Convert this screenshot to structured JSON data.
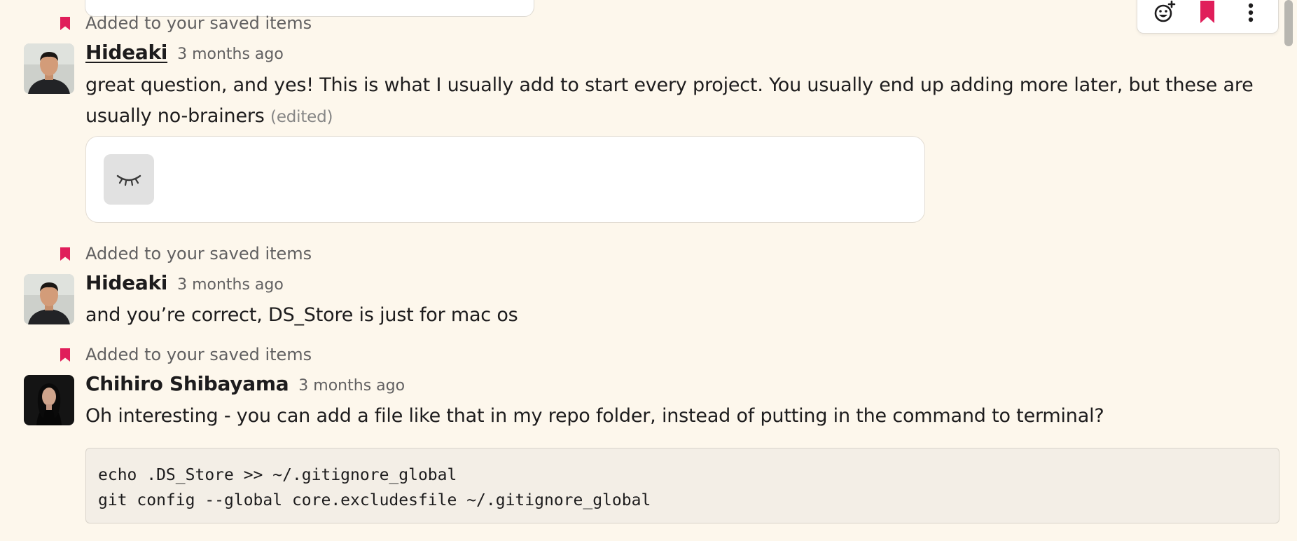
{
  "messages": [
    {
      "saved_label": "Added to your saved items",
      "author": "Hideaki",
      "time": "3 months ago",
      "text": "great question, and yes! This is what I usually add to start every project. You usually end up adding more later, but these are usually no-brainers",
      "edited": "(edited)"
    },
    {
      "saved_label": "Added to your saved items",
      "author": "Hideaki",
      "time": "3 months ago",
      "text": "and you’re correct, DS_Store is just for mac os"
    },
    {
      "saved_label": "Added to your saved items",
      "author": "Chihiro Shibayama",
      "time": "3 months ago",
      "text": "Oh interesting - you can add a file like that in my repo folder, instead of putting in the command to terminal?",
      "code": [
        "echo .DS_Store >> ~/.gitignore_global",
        "git config --global core.excludesfile ~/.gitignore_global"
      ]
    }
  ],
  "toolbar": {
    "icons": [
      "add-reaction-icon",
      "bookmark-icon",
      "more-actions-icon"
    ]
  },
  "colors": {
    "background": "#fdf7ec",
    "bookmark": "#e01e5a",
    "code_background": "#f3eee6"
  }
}
